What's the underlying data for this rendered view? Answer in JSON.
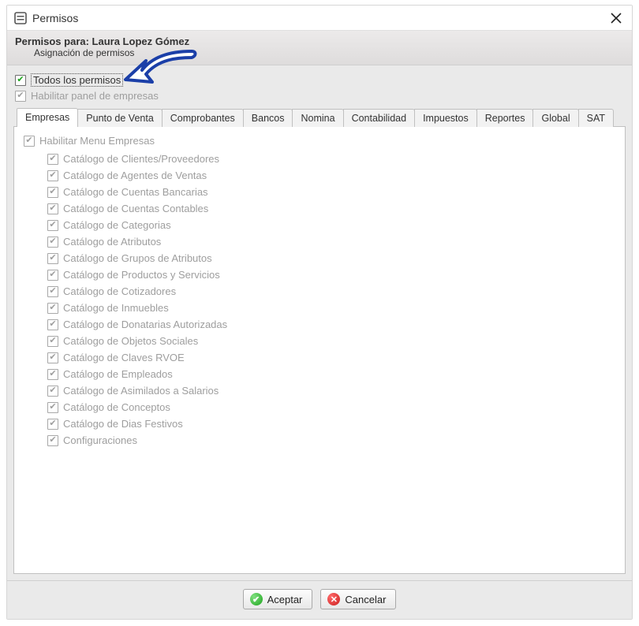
{
  "window": {
    "title": "Permisos",
    "close_tooltip": "Cerrar"
  },
  "header": {
    "line1_prefix": "Permisos para: ",
    "user": "Laura Lopez Gómez",
    "line2": "Asignación de permisos"
  },
  "top_checks": {
    "all_permissions": {
      "label": "Todos los permisos",
      "checked": true,
      "enabled": true
    },
    "enable_companies_panel": {
      "label": "Habilitar panel de empresas",
      "checked": true,
      "enabled": false
    }
  },
  "tabs": [
    {
      "key": "empresas",
      "label": "Empresas",
      "active": true
    },
    {
      "key": "pdv",
      "label": "Punto de Venta"
    },
    {
      "key": "comprobantes",
      "label": "Comprobantes"
    },
    {
      "key": "bancos",
      "label": "Bancos"
    },
    {
      "key": "nomina",
      "label": "Nomina"
    },
    {
      "key": "contabilidad",
      "label": "Contabilidad"
    },
    {
      "key": "impuestos",
      "label": "Impuestos"
    },
    {
      "key": "reportes",
      "label": "Reportes"
    },
    {
      "key": "global",
      "label": "Global"
    },
    {
      "key": "sat",
      "label": "SAT"
    }
  ],
  "panel": {
    "root": {
      "label": "Habilitar Menu Empresas",
      "checked": true,
      "enabled": false
    },
    "items": [
      {
        "label": "Catálogo de Clientes/Proveedores",
        "checked": true,
        "enabled": false
      },
      {
        "label": "Catálogo de Agentes de Ventas",
        "checked": true,
        "enabled": false
      },
      {
        "label": "Catálogo de Cuentas Bancarias",
        "checked": true,
        "enabled": false
      },
      {
        "label": "Catálogo de Cuentas Contables",
        "checked": true,
        "enabled": false
      },
      {
        "label": "Catálogo de Categorias",
        "checked": true,
        "enabled": false
      },
      {
        "label": "Catálogo de Atributos",
        "checked": true,
        "enabled": false
      },
      {
        "label": "Catálogo de Grupos de Atributos",
        "checked": true,
        "enabled": false
      },
      {
        "label": "Catálogo de Productos y Servicios",
        "checked": true,
        "enabled": false
      },
      {
        "label": "Catálogo de Cotizadores",
        "checked": true,
        "enabled": false
      },
      {
        "label": "Catálogo de Inmuebles",
        "checked": true,
        "enabled": false
      },
      {
        "label": "Catálogo de Donatarias Autorizadas",
        "checked": true,
        "enabled": false
      },
      {
        "label": "Catálogo de Objetos Sociales",
        "checked": true,
        "enabled": false
      },
      {
        "label": "Catálogo de Claves RVOE",
        "checked": true,
        "enabled": false
      },
      {
        "label": "Catálogo de Empleados",
        "checked": true,
        "enabled": false
      },
      {
        "label": "Catálogo de Asimilados a Salarios",
        "checked": true,
        "enabled": false
      },
      {
        "label": "Catálogo de Conceptos",
        "checked": true,
        "enabled": false
      },
      {
        "label": "Catálogo de Dias Festivos",
        "checked": true,
        "enabled": false
      },
      {
        "label": "Configuraciones",
        "checked": true,
        "enabled": false
      }
    ]
  },
  "footer": {
    "accept": "Aceptar",
    "cancel": "Cancelar"
  },
  "colors": {
    "accent_green": "#19a319",
    "accent_red": "#cc1f1f",
    "arrow_stroke": "#1b3fa8",
    "arrow_fill": "#ffffff"
  }
}
